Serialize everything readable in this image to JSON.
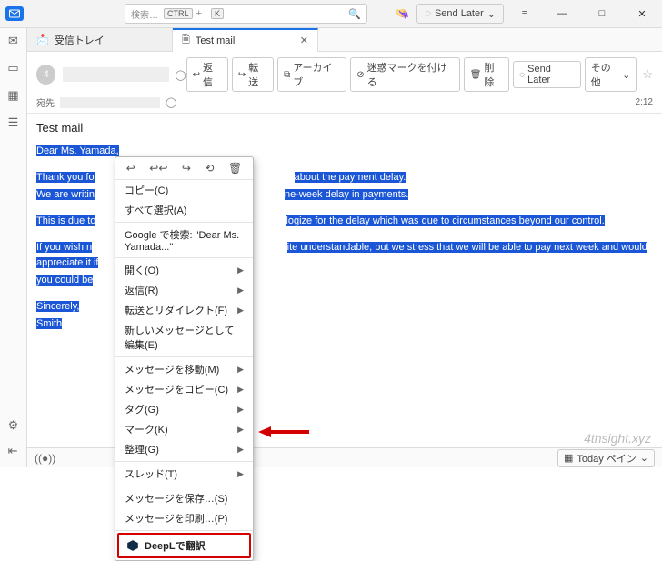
{
  "titlebar": {
    "search_placeholder": "検索…",
    "kbd1": "CTRL",
    "kbd2": "K",
    "plus": "+",
    "send_later": "Send Later"
  },
  "tabs": {
    "inbox": "受信トレイ",
    "mail": "Test mail"
  },
  "header": {
    "avatar_initial": "4",
    "to_label": "宛先",
    "time": "2:12",
    "actions": {
      "reply": "返信",
      "fwd": "転送",
      "archive": "アーカイブ",
      "junk": "迷惑マークを付ける",
      "delete": "削除",
      "sendlater": "Send Later",
      "other": "その他"
    }
  },
  "subject": "Test mail",
  "body": {
    "l1": "Dear Ms. Yamada,",
    "l2a": "Thank you fo",
    "l2b": "about the payment delay.",
    "l3": "We are writin",
    "l3b": "ne-week delay in payments.",
    "l4a": "This is due to",
    "l4b": "logize for the delay which was due to circumstances beyond our control.",
    "l5a": "If you wish n",
    "l5b": "ite understandable, but we stress that we will be able to pay next week and would appreciate it if",
    "l6": "you could be",
    "l7": "Sincerely,",
    "l8": "Smith"
  },
  "ctx": {
    "copy": "コピー(C)",
    "select_all": "すべて選択(A)",
    "google": "Google で検索: \"Dear Ms. Yamada...\"",
    "open": "開く(O)",
    "reply": "返信(R)",
    "fwd_redirect": "転送とリダイレクト(F)",
    "edit_new": "新しいメッセージとして編集(E)",
    "move": "メッセージを移動(M)",
    "copy_msg": "メッセージをコピー(C)",
    "tag": "タグ(G)",
    "mark": "マーク(K)",
    "organize": "整理(G)",
    "thread": "スレッド(T)",
    "save": "メッセージを保存…(S)",
    "print": "メッセージを印刷…(P)",
    "deepl": "DeepLで翻訳"
  },
  "footer": {
    "today": "Today ペイン"
  },
  "watermark": "4thsight.xyz"
}
